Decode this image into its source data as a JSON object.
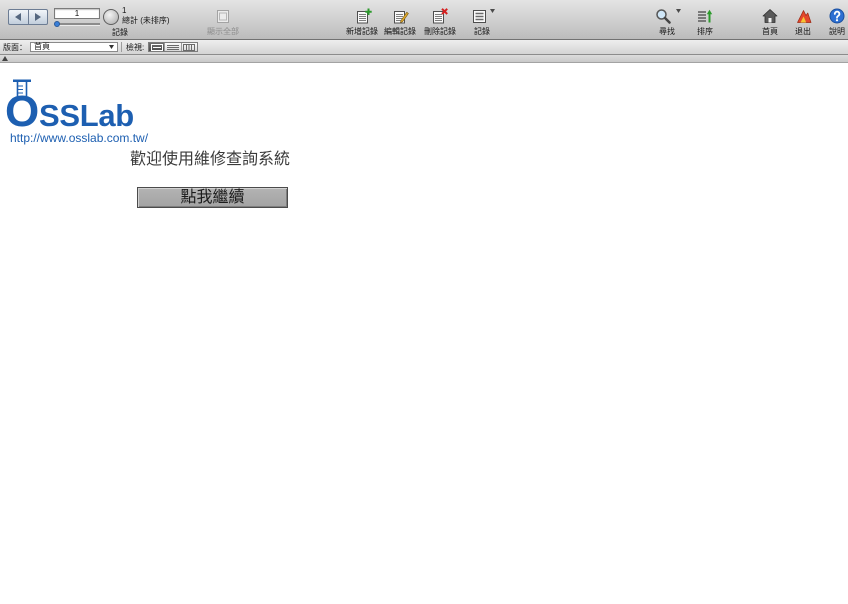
{
  "colors": {
    "toolbar_top": "#e4e4e4",
    "toolbar_bottom": "#bcbcbc",
    "logo_blue": "#1d5fb1",
    "button_face": "#a3a3a3",
    "slider_knob": "#3a7fd8"
  },
  "toolbar": {
    "record_navigator": {
      "icon": "book-navigation-icon",
      "current_record": "1",
      "found_count": "1",
      "total_status": "總計 (未排序)",
      "label": "記錄"
    },
    "show_all": {
      "label": "顯示全部",
      "icon": "show-all-icon",
      "enabled": false
    },
    "record_actions": [
      {
        "label": "新增記錄",
        "icon": "new-record-icon"
      },
      {
        "label": "編輯記錄",
        "icon": "edit-record-icon"
      },
      {
        "label": "刪除記錄",
        "icon": "delete-record-icon"
      },
      {
        "label": "記錄",
        "icon": "records-menu-icon",
        "dropdown": true
      }
    ],
    "right_actions": [
      {
        "label": "尋找",
        "icon": "search-icon",
        "dropdown": true
      },
      {
        "label": "排序",
        "icon": "sort-icon"
      },
      {
        "label": "首頁",
        "icon": "home-icon"
      },
      {
        "label": "退出",
        "icon": "exit-icon"
      },
      {
        "label": "說明",
        "icon": "help-icon"
      }
    ]
  },
  "layout_bar": {
    "layout_label": "版面：",
    "layout_value": "首頁",
    "view_label": "檢視:",
    "view_modes": [
      {
        "icon": "form-view-icon",
        "active": true
      },
      {
        "icon": "list-view-icon",
        "active": false
      },
      {
        "icon": "table-view-icon",
        "active": false
      }
    ]
  },
  "status_strip": {
    "toggle_icon": "chevron-up-icon"
  },
  "content": {
    "logo": {
      "text": "OSSLab",
      "url_text": "http://www.osslab.com.tw/",
      "icon": "flask-icon"
    },
    "welcome_text": "歡迎使用維修查詢系統",
    "continue_button": "點我繼續"
  }
}
